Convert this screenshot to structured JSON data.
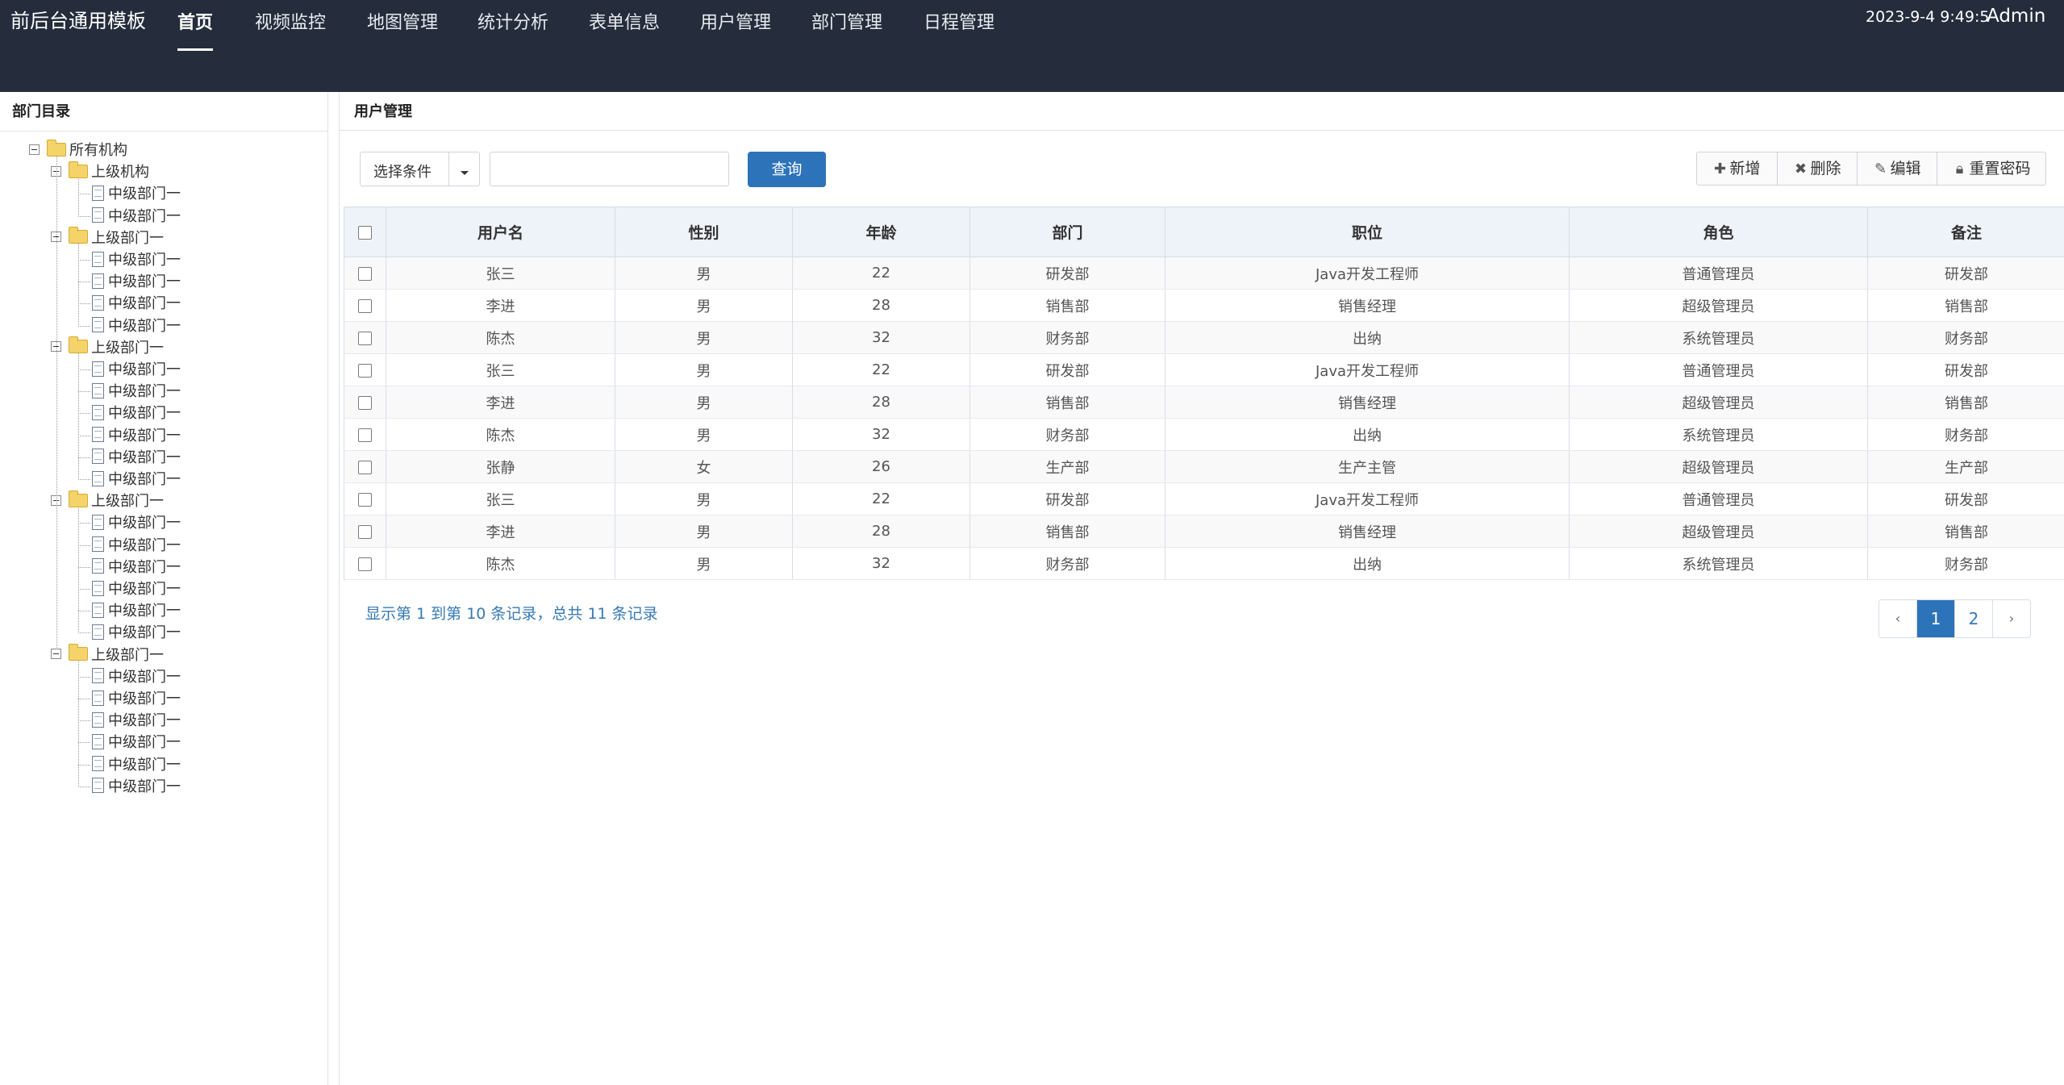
{
  "header": {
    "brand": "前后台通用模板",
    "nav": [
      {
        "label": "首页",
        "active": true
      },
      {
        "label": "视频监控",
        "active": false
      },
      {
        "label": "地图管理",
        "active": false
      },
      {
        "label": "统计分析",
        "active": false
      },
      {
        "label": "表单信息",
        "active": false
      },
      {
        "label": "用户管理",
        "active": false
      },
      {
        "label": "部门管理",
        "active": false
      },
      {
        "label": "日程管理",
        "active": false
      }
    ],
    "datetime": "2023-9-4 9:49:5",
    "user": "Admin"
  },
  "sidebar": {
    "title": "部门目录",
    "root": "所有机构",
    "groups": [
      {
        "label": "上级机构",
        "children": [
          "中级部门一",
          "中级部门一"
        ]
      },
      {
        "label": "上级部门一",
        "children": [
          "中级部门一",
          "中级部门一",
          "中级部门一",
          "中级部门一"
        ]
      },
      {
        "label": "上级部门一",
        "children": [
          "中级部门一",
          "中级部门一",
          "中级部门一",
          "中级部门一",
          "中级部门一",
          "中级部门一"
        ]
      },
      {
        "label": "上级部门一",
        "children": [
          "中级部门一",
          "中级部门一",
          "中级部门一",
          "中级部门一",
          "中级部门一",
          "中级部门一"
        ]
      },
      {
        "label": "上级部门一",
        "children": [
          "中级部门一",
          "中级部门一",
          "中级部门一",
          "中级部门一",
          "中级部门一",
          "中级部门一"
        ]
      }
    ]
  },
  "main": {
    "title": "用户管理",
    "filter": {
      "select_label": "选择条件",
      "search_value": "",
      "query_label": "查询"
    },
    "toolbar": {
      "add_label": "新增",
      "delete_label": "删除",
      "edit_label": "编辑",
      "reset_label": "重置密码"
    },
    "table": {
      "columns": [
        "用户名",
        "性别",
        "年龄",
        "部门",
        "职位",
        "角色",
        "备注"
      ],
      "rows": [
        [
          "张三",
          "男",
          "22",
          "研发部",
          "Java开发工程师",
          "普通管理员",
          "研发部"
        ],
        [
          "李进",
          "男",
          "28",
          "销售部",
          "销售经理",
          "超级管理员",
          "销售部"
        ],
        [
          "陈杰",
          "男",
          "32",
          "财务部",
          "出纳",
          "系统管理员",
          "财务部"
        ],
        [
          "张三",
          "男",
          "22",
          "研发部",
          "Java开发工程师",
          "普通管理员",
          "研发部"
        ],
        [
          "李进",
          "男",
          "28",
          "销售部",
          "销售经理",
          "超级管理员",
          "销售部"
        ],
        [
          "陈杰",
          "男",
          "32",
          "财务部",
          "出纳",
          "系统管理员",
          "财务部"
        ],
        [
          "张静",
          "女",
          "26",
          "生产部",
          "生产主管",
          "超级管理员",
          "生产部"
        ],
        [
          "张三",
          "男",
          "22",
          "研发部",
          "Java开发工程师",
          "普通管理员",
          "研发部"
        ],
        [
          "李进",
          "男",
          "28",
          "销售部",
          "销售经理",
          "超级管理员",
          "销售部"
        ],
        [
          "陈杰",
          "男",
          "32",
          "财务部",
          "出纳",
          "系统管理员",
          "财务部"
        ]
      ]
    },
    "summary": "显示第 1 到第 10 条记录，总共 11 条记录",
    "pagination": {
      "prev": "‹",
      "pages": [
        "1",
        "2"
      ],
      "current": "1",
      "next": "›"
    }
  }
}
